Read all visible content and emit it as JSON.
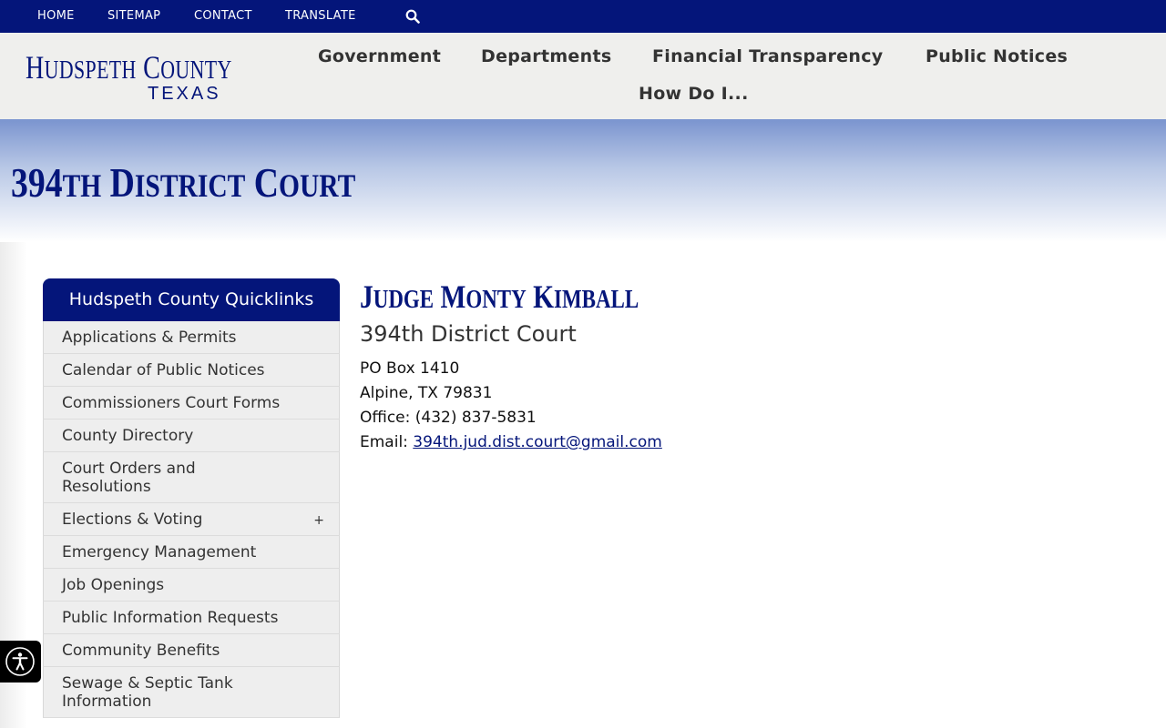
{
  "utility_nav": {
    "links": [
      "HOME",
      "SITEMAP",
      "CONTACT",
      "TRANSLATE"
    ],
    "search_icon": "search-icon"
  },
  "logo": {
    "line1_cap1": "H",
    "line1_rest1": "UDSPETH",
    "line1_cap2": "C",
    "line1_rest2": "OUNTY",
    "line2": "TEXAS"
  },
  "main_nav": [
    "Government",
    "Departments",
    "Financial Transparency",
    "Public Notices",
    "How Do I..."
  ],
  "page": {
    "title_num": "394",
    "title_suffix": "TH",
    "title_cap1": "D",
    "title_rest1": "ISTRICT",
    "title_cap2": "C",
    "title_rest2": "OURT"
  },
  "quicklinks": {
    "header": "Hudspeth County Quicklinks",
    "items": [
      "Applications & Permits",
      "Calendar of Public Notices",
      "Commissioners Court Forms",
      "County Directory",
      "Court Orders and Resolutions",
      "Elections & Voting",
      "Emergency Management",
      "Job Openings",
      "Public Information Requests",
      "Community Benefits",
      "Sewage & Septic Tank Information"
    ],
    "expand_symbol": "+"
  },
  "content": {
    "judge_cap1": "J",
    "judge_rest1": "UDGE",
    "judge_cap2": "M",
    "judge_rest2": "ONTY",
    "judge_cap3": "K",
    "judge_rest3": "IMBALL",
    "court": "394th District Court",
    "po_box": "PO Box 1410",
    "city": "Alpine, TX 79831",
    "office": "Office: (432) 837-5831",
    "email_label": "Email: ",
    "email": "394th.jud.dist.court@gmail.com"
  },
  "colors": {
    "brand_navy": "#04157a",
    "header_bg": "#efefed",
    "sidebar_item_bg": "#eeeeee"
  },
  "accessibility": {
    "icon": "accessibility-icon"
  }
}
